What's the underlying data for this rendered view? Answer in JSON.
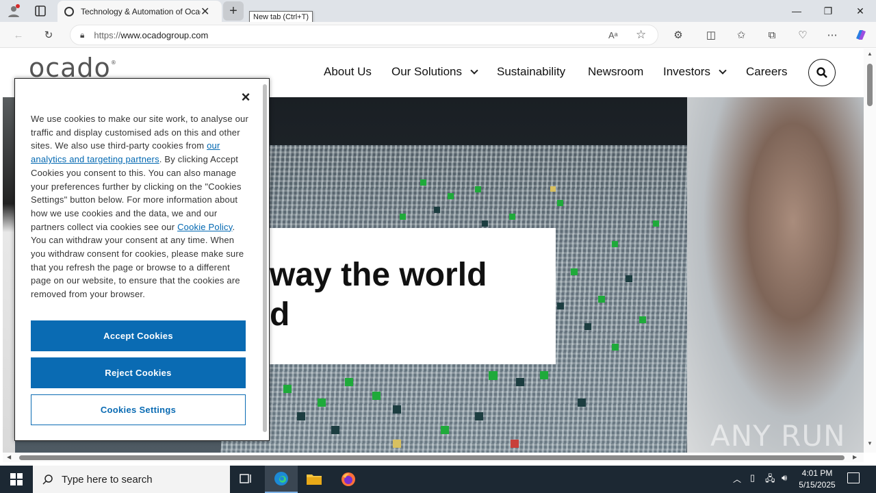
{
  "browser": {
    "tab_title": "Technology & Automation of Ocado",
    "newtab_tooltip": "New tab (Ctrl+T)",
    "url_prefix": "https://",
    "url_host": "www.ocadogroup.com"
  },
  "site": {
    "logo": "ocado",
    "nav": [
      "About Us",
      "Our Solutions",
      "Sustainability",
      "Newsroom",
      "Investors",
      "Careers"
    ]
  },
  "hero": {
    "line1": "way the world",
    "line2": "d"
  },
  "cookie_banner": {
    "text_part1": "We use cookies to make our site work, to analyse our traffic and display customised ads on this and other sites. We also use third-party cookies from ",
    "link1": "our analytics and targeting partners",
    "text_part2": ". By clicking Accept Cookies you consent to this. You can also manage your preferences further by clicking on the \"Cookies Settings\" button below. For more information about how we use cookies and the data, we and our partners collect via cookies see our ",
    "link2": "Cookie Policy",
    "text_part3": ". You can withdraw your consent at any time. When you withdraw consent for cookies, please make sure that you refresh the page or browse to a different page on our website, to ensure that the cookies are removed from your browser.",
    "accept": "Accept Cookies",
    "reject": "Reject Cookies",
    "settings": "Cookies Settings"
  },
  "watermark": "ANY RUN",
  "taskbar": {
    "search_placeholder": "Type here to search",
    "time": "4:01 PM",
    "date": "5/15/2025"
  },
  "colors": {
    "accent_blue": "#0a6bb3",
    "taskbar": "#1c2833"
  }
}
